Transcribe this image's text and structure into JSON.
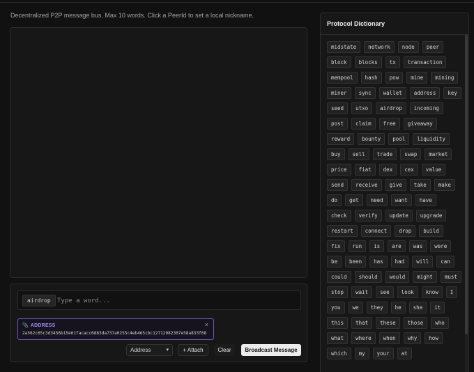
{
  "description": "Decentralized P2P message bus. Max 10 words. Click a PeerId to set a local nickname.",
  "composer": {
    "current_chip": "airdrop",
    "input_placeholder": "Type a word...",
    "attachment": {
      "label": "ADDRESS",
      "close_icon": "×",
      "value": "2a562c65c3d3456b15e61facacc6883da737a0255c4eb465cbc12712082307e58a833f08"
    },
    "type_select": "Address",
    "attach_button": "+ Attach",
    "clear_button": "Clear",
    "broadcast_button": "Broadcast Message"
  },
  "dictionary": {
    "title": "Protocol Dictionary",
    "words": [
      "midstate",
      "network",
      "node",
      "peer",
      "block",
      "blocks",
      "tx",
      "transaction",
      "mempool",
      "hash",
      "pow",
      "mine",
      "mining",
      "miner",
      "sync",
      "wallet",
      "address",
      "key",
      "seed",
      "utxo",
      "airdrop",
      "incoming",
      "post",
      "claim",
      "free",
      "giveaway",
      "reward",
      "bounty",
      "pool",
      "liquidity",
      "buy",
      "sell",
      "trade",
      "swap",
      "market",
      "price",
      "fiat",
      "dex",
      "cex",
      "value",
      "send",
      "receive",
      "give",
      "take",
      "make",
      "do",
      "get",
      "need",
      "want",
      "have",
      "check",
      "verify",
      "update",
      "upgrade",
      "restart",
      "connect",
      "drop",
      "build",
      "fix",
      "run",
      "is",
      "are",
      "was",
      "were",
      "be",
      "been",
      "has",
      "had",
      "will",
      "can",
      "could",
      "should",
      "would",
      "might",
      "must",
      "stop",
      "wait",
      "see",
      "look",
      "know",
      "I",
      "you",
      "we",
      "they",
      "he",
      "she",
      "it",
      "this",
      "that",
      "these",
      "those",
      "who",
      "what",
      "where",
      "when",
      "why",
      "how",
      "which",
      "my",
      "your",
      "at"
    ]
  }
}
